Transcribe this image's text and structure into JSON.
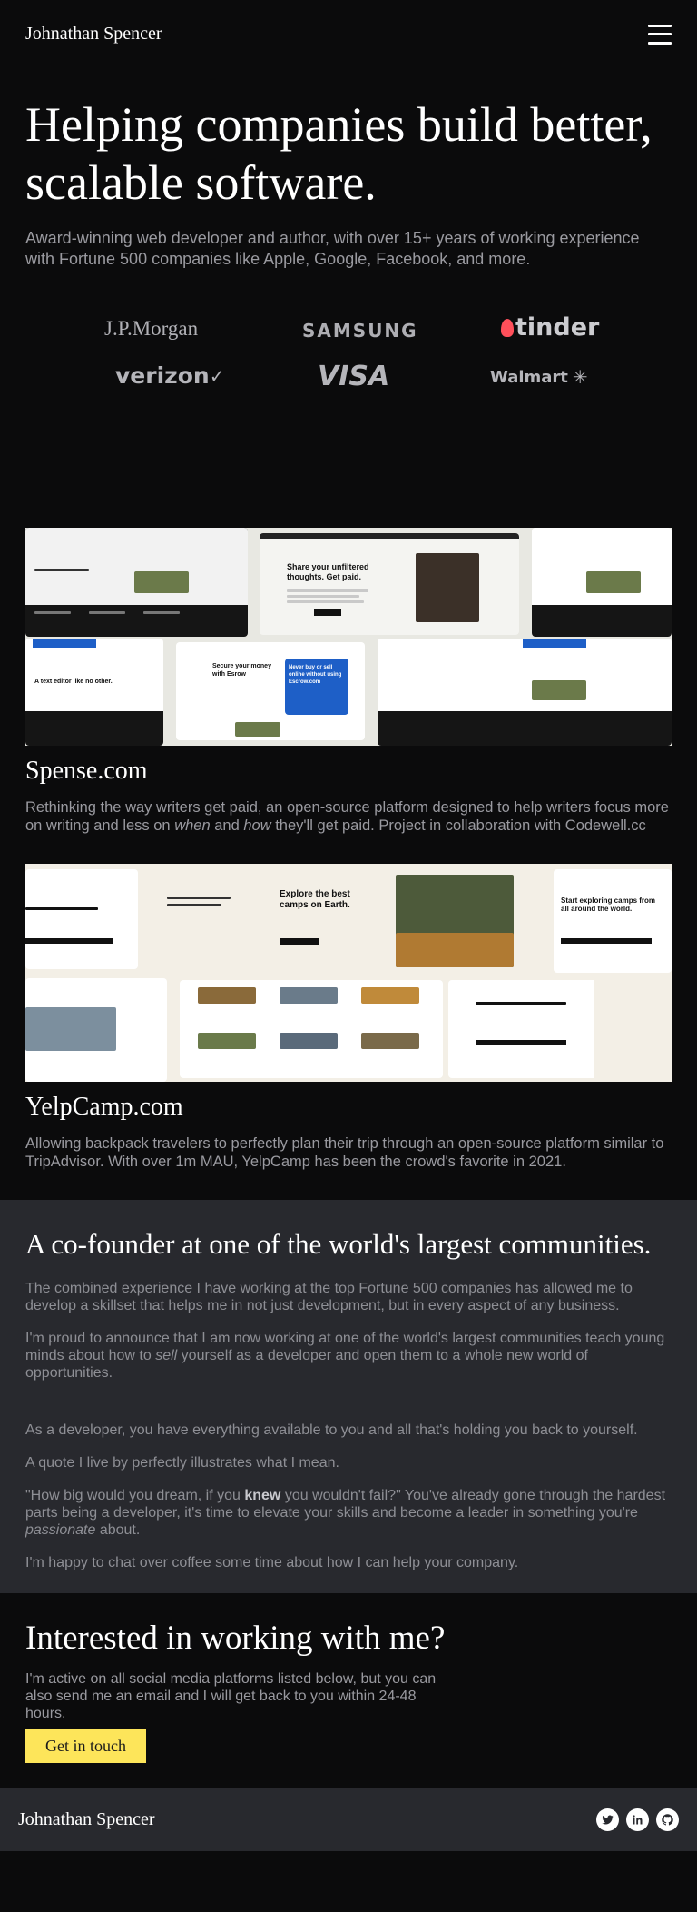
{
  "header": {
    "brand": "Johnathan Spencer",
    "menu_icon": "hamburger-menu-icon"
  },
  "hero": {
    "title": "Helping companies build better, scalable software.",
    "subtitle": "Award-winning web developer and author, with over 15+ years of working experience with Fortune 500 companies like Apple, Google, Facebook, and more."
  },
  "logos": {
    "jpmorgan": "J.P.Morgan",
    "samsung": "SAMSUNG",
    "tinder": "tinder",
    "verizon": "verizon",
    "visa": "VISA",
    "walmart": "Walmart"
  },
  "projects": [
    {
      "title": "Spense.com",
      "description_a": "Rethinking the way writers get paid, an open-source platform designed to help writers focus more on writing and less on ",
      "when": "when",
      "and": " and ",
      "how": "how",
      "description_b": " they'll get paid. Project in collaboration with Codewell.cc",
      "shot_headline": "Share your unfiltered thoughts. Get paid.",
      "shot_card_a": "Secure your money with Esrow",
      "shot_card_b": "Never buy or sell online without using Escrow.com",
      "shot_card_c": "A text editor like no other."
    },
    {
      "title": "YelpCamp.com",
      "description": "Allowing backpack travelers to perfectly plan their trip through an open-source platform similar to TripAdvisor. With over 1m MAU, YelpCamp has been the crowd's favorite in 2021.",
      "shot_headline": "Explore the best camps on Earth.",
      "shot_card_a": "Start exploring camps from all around the world."
    }
  ],
  "cofounder": {
    "title": "A co-founder at one of the world's largest communities.",
    "p1": "The combined experience I have working at the top Fortune 500 companies has allowed me to develop a skillset that helps me in not just development, but in every aspect of any business.",
    "p2_a": "I'm proud to announce that I am now working at one of the world's largest communities teach young minds about how to ",
    "p2_em": "sell",
    "p2_b": " yourself as a developer and open them to a whole new world of opportunities.",
    "p3": "As a developer, you have everything available to you and all that's holding you back to yourself.",
    "p4": "A quote I live by perfectly illustrates what I mean.",
    "p5_a": "\"How big would you dream, if you ",
    "p5_strong": "knew",
    "p5_b": " you wouldn't fail?\" You've already gone through the hardest parts being a developer, it's time to elevate your skills and become a leader in something you're ",
    "p5_em": "passionate",
    "p5_c": " about.",
    "p6": "I'm happy to chat over coffee some time about how I can help your company."
  },
  "contact": {
    "title": "Interested in working with me?",
    "text": "I'm active on all social media platforms listed below, but you can also send me an email and I will get back to you within 24-48 hours.",
    "button": "Get in touch"
  },
  "footer": {
    "brand": "Johnathan Spencer",
    "socials": [
      "twitter-icon",
      "linkedin-icon",
      "github-icon"
    ]
  }
}
